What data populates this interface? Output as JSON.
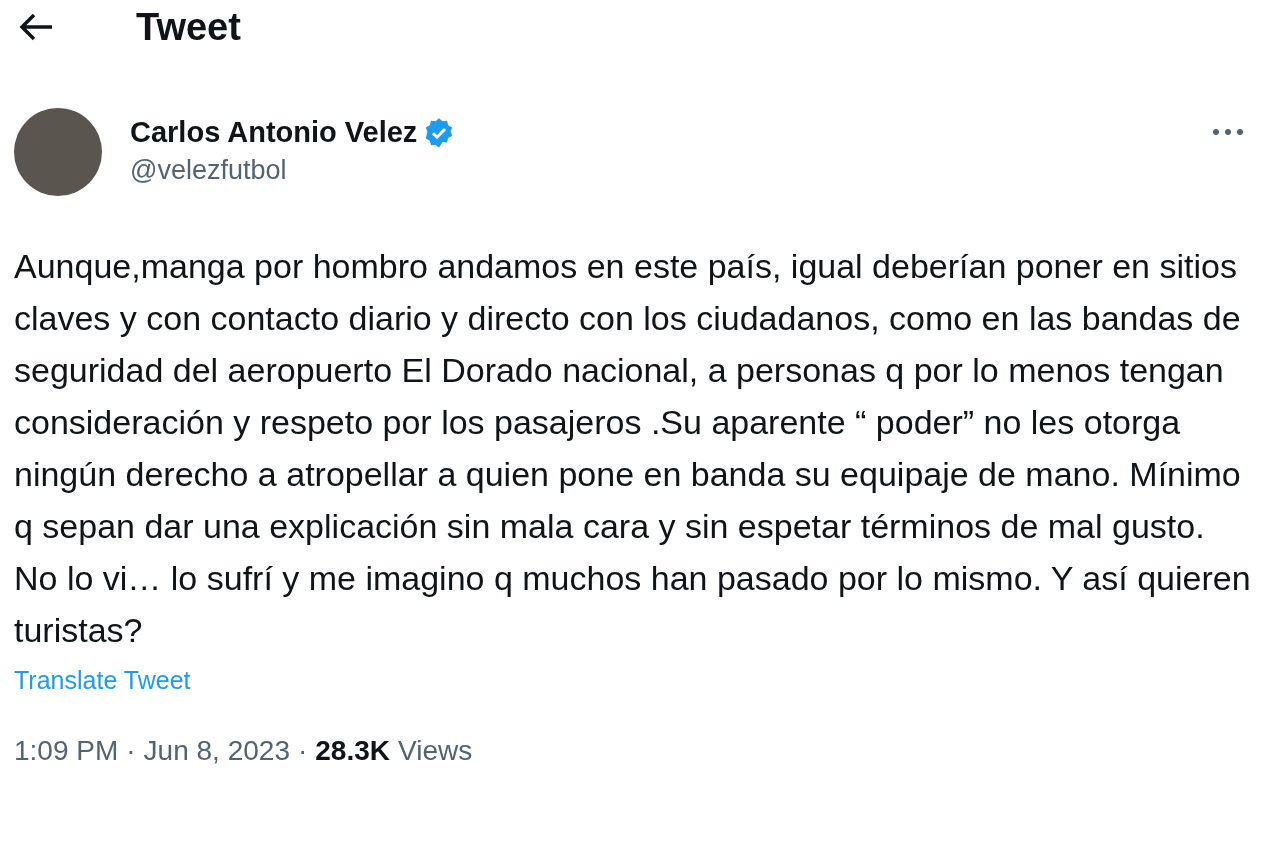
{
  "header": {
    "title": "Tweet"
  },
  "author": {
    "name": "Carlos Antonio Velez",
    "verified": true,
    "handle": "@velezfutbol"
  },
  "tweet": {
    "text": "Aunque,manga por hombro andamos en este país, igual deberían poner en sitios claves y con contacto diario y directo con los ciudadanos, como en las bandas de seguridad del aeropuerto El Dorado nacional, a personas q por lo menos tengan consideración y respeto por los pasajeros .Su aparente “ poder” no les otorga ningún derecho a atropellar a quien pone en banda su equipaje de mano. Mínimo q sepan dar una explicación sin mala cara y sin espetar términos de mal gusto. No lo vi… lo sufrí y me imagino q muchos han pasado por lo mismo. Y así quieren turistas?",
    "translate": "Translate Tweet"
  },
  "meta": {
    "time": "1:09 PM",
    "separator_1": "·",
    "date": "Jun 8, 2023",
    "separator_2": "·",
    "views_count": "28.3K",
    "views_label": "Views"
  }
}
